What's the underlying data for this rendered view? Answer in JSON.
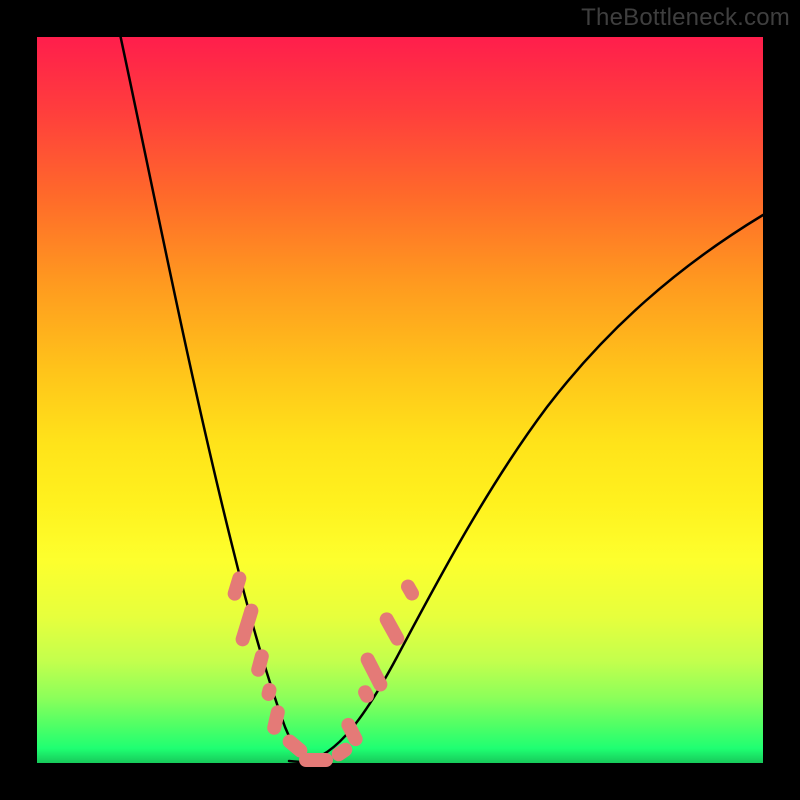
{
  "watermark": "TheBottleneck.com",
  "chart_data": {
    "type": "line",
    "title": "",
    "xlabel": "",
    "ylabel": "",
    "x": [
      0.0,
      0.05,
      0.1,
      0.15,
      0.2,
      0.25,
      0.275,
      0.3,
      0.325,
      0.35,
      0.375,
      0.4,
      0.45,
      0.5,
      0.55,
      0.6,
      0.65,
      0.7,
      0.75,
      0.8,
      0.85,
      0.9,
      0.95,
      1.0
    ],
    "series": [
      {
        "name": "bottleneck-curve",
        "values": [
          1.06,
          0.9,
          0.74,
          0.58,
          0.42,
          0.26,
          0.18,
          0.1,
          0.04,
          0.0,
          0.0,
          0.02,
          0.1,
          0.2,
          0.3,
          0.39,
          0.47,
          0.54,
          0.6,
          0.65,
          0.69,
          0.72,
          0.74,
          0.76
        ]
      }
    ],
    "xlim": [
      0,
      1
    ],
    "ylim": [
      0,
      1
    ],
    "annotations": {
      "bead_segments": [
        {
          "x_start": 0.233,
          "x_end": 0.255
        },
        {
          "x_start": 0.264,
          "x_end": 0.302
        },
        {
          "x_start": 0.307,
          "x_end": 0.33
        },
        {
          "x_start": 0.285,
          "x_end": 0.3
        },
        {
          "x_start": 0.33,
          "x_end": 0.36
        },
        {
          "x_start": 0.36,
          "x_end": 0.415
        },
        {
          "x_start": 0.4,
          "x_end": 0.42
        },
        {
          "x_start": 0.425,
          "x_end": 0.458
        },
        {
          "x_start": 0.462,
          "x_end": 0.502
        },
        {
          "x_start": 0.45,
          "x_end": 0.472
        },
        {
          "x_start": 0.505,
          "x_end": 0.53
        }
      ]
    }
  },
  "colors": {
    "bead": "#e47a77",
    "curve": "#000000",
    "background_frame": "#000000"
  }
}
